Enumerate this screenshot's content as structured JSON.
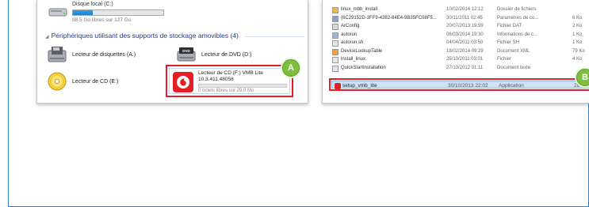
{
  "computer_panel": {
    "disk": {
      "name": "Disque local (C:)",
      "free_text": "98,5 Go libres sur 127 Go",
      "used_fraction": 0.22
    },
    "section_title": "Périphériques utilisant des supports de stockage amovibles (4)",
    "devices": [
      {
        "label": "Lecteur de disquettes (A:)",
        "icon": "floppy-drive-icon"
      },
      {
        "label": "Lecteur de DVD (D:)",
        "icon": "dvd-drive-icon"
      },
      {
        "label": "Lecteur de CD (E:)",
        "icon": "cd-drive-icon"
      }
    ],
    "highlighted_drive": {
      "title": "Lecteur de CD (F:) VMB Lite",
      "version": "10.3.411.48058",
      "free_text": "0 octets libres sur 29,0 Mo",
      "icon": "vodafone-logo-icon"
    },
    "badge": "A"
  },
  "files_panel": {
    "files": [
      {
        "name": "linux_mbb_install",
        "date": "10/02/2014 12:12",
        "type": "Dossier de fichiers",
        "size": "",
        "icon": "folder-icon"
      },
      {
        "name": "{6C29152D-3FF9-4382-84E4-9B35FC08F5...",
        "date": "30/11/2011 02:45",
        "type": "Paramètres de co...",
        "size": "6 Ko",
        "icon": "settings-file-icon"
      },
      {
        "name": "ArConfig",
        "date": "20/07/2013 19:59",
        "type": "Fichier DAT",
        "size": "2 Ko",
        "icon": "dat-file-icon"
      },
      {
        "name": "autorun",
        "date": "06/03/2014 19:30",
        "type": "Informations de c...",
        "size": "1 Ko",
        "icon": "autorun-file-icon"
      },
      {
        "name": "autorun.sh",
        "date": "04/04/2011 03:50",
        "type": "Fichier SH",
        "size": "1 Ko",
        "icon": "sh-file-icon"
      },
      {
        "name": "DeviceLookupTable",
        "date": "18/02/2014 09:29",
        "type": "Document XML",
        "size": "79 Ko",
        "icon": "xml-file-icon"
      },
      {
        "name": "install_linux",
        "date": "25/10/2011 03:01",
        "type": "Fichier",
        "size": "4 Ko",
        "icon": "file-icon"
      },
      {
        "name": "QuickStartInstallation",
        "date": "27/10/2012 01:11",
        "type": "Document texte",
        "size": "",
        "icon": "text-file-icon"
      }
    ],
    "selected_file": {
      "name": "setup_vmb_lite",
      "date": "30/10/2013 22:02",
      "type": "Application",
      "size": "28...",
      "icon": "vodafone-app-icon"
    },
    "badge": "B"
  },
  "colors": {
    "highlight_border": "#e0202a",
    "badge_green": "#7fbf3f",
    "frame_blue": "#2f7fd4",
    "vodafone_red": "#e31e24",
    "selection_blue": "#cfe3f8"
  }
}
